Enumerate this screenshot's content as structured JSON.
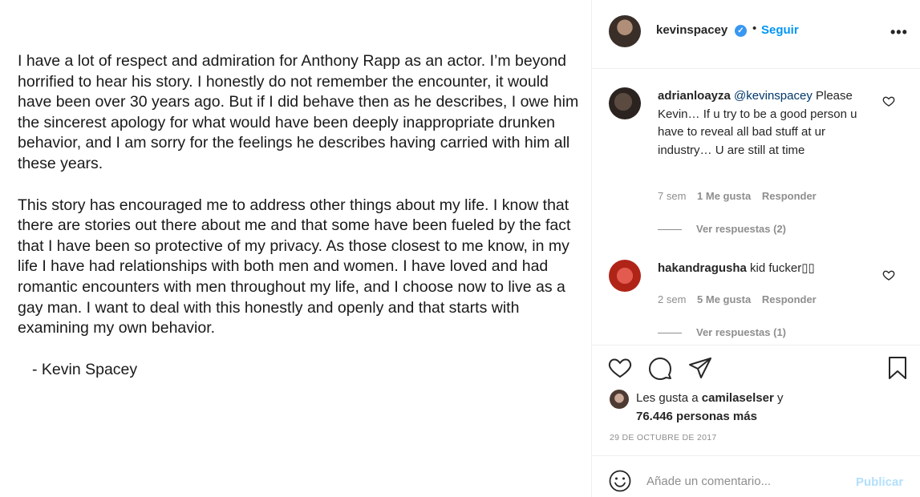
{
  "post": {
    "statement_paragraphs": [
      "I have a lot of respect and admiration for Anthony Rapp as an actor. I’m beyond horrified to hear his story. I honestly do not remember the encounter, it would have been over 30 years ago. But if I did behave then as he describes, I owe him the sincerest apology for what would have been deeply inappropriate drunken behavior, and I am sorry for the feelings he describes having carried with him all these years.",
      "This story has encouraged me to address other things about my life. I know that there are stories out there about me and that some have been fueled by the fact that I have been so protective of my privacy. As those closest to me know, in my life I have had relationships with both men and women. I have loved and had romantic encounters with men throughout my life, and I choose now to live as a gay man.  I want to deal with this honestly and openly and that starts with examining my own behavior."
    ],
    "signature": "- Kevin Spacey"
  },
  "header": {
    "username": "kevinspacey",
    "separator": "•",
    "follow_label": "Seguir",
    "more_label": "•••"
  },
  "comments": [
    {
      "username": "adrianloayza",
      "mention": "@kevinspacey",
      "text": "Please Kevin… If u try to be a good person u have to reveal all bad stuff at ur industry… U are still at time",
      "time": "7 sem",
      "likes": "1 Me gusta",
      "reply_label": "Responder",
      "view_replies": "Ver respuestas (2)"
    },
    {
      "username": "hakandragusha",
      "mention": "",
      "text": "kid fucker▯▯",
      "time": "2 sem",
      "likes": "5 Me gusta",
      "reply_label": "Responder",
      "view_replies": "Ver respuestas (1)"
    }
  ],
  "likes": {
    "prefix": "Les gusta a ",
    "user": "camilaselser",
    "suffix": " y",
    "count_text": "76.446 personas más"
  },
  "date": "29 DE OCTUBRE DE 2017",
  "add_comment": {
    "placeholder": "Añade un comentario...",
    "publish_label": "Publicar"
  },
  "icons": {
    "like": "heart-icon",
    "comment": "comment-bubble-icon",
    "share": "paper-plane-icon",
    "save": "bookmark-icon",
    "emoji": "smiley-icon"
  },
  "colors": {
    "link_blue": "#0095f6",
    "verified_blue": "#3897f0",
    "muted_gray": "#8e8e8e",
    "publish_disabled": "#b2dffc"
  }
}
